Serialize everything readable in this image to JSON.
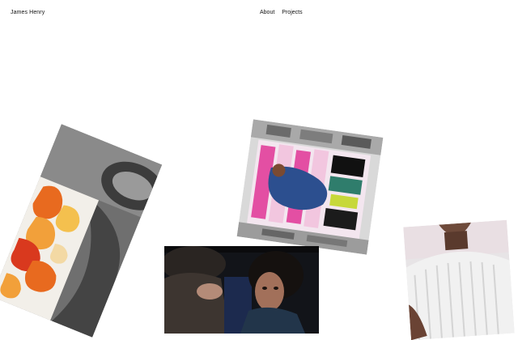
{
  "site": {
    "brand": "James Henry"
  },
  "nav": {
    "items": [
      {
        "label": "About"
      },
      {
        "label": "Projects"
      }
    ]
  },
  "gallery": {
    "cards": [
      {
        "name": "project-card-illustration"
      },
      {
        "name": "project-card-magazine"
      },
      {
        "name": "project-card-film-still"
      },
      {
        "name": "project-card-knitwear"
      }
    ]
  }
}
